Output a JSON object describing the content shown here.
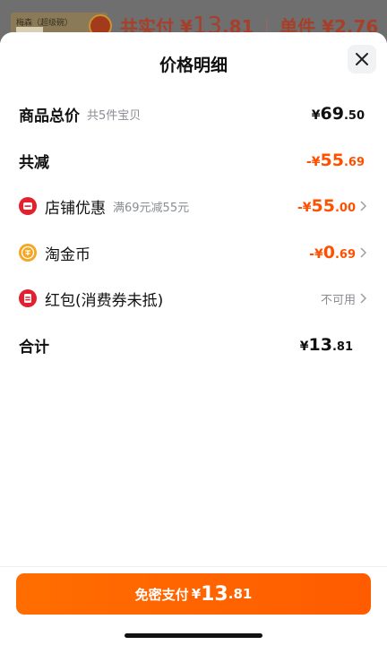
{
  "background": {
    "thumb_label": "梅森（超级碗）",
    "paid_prefix": "共实付",
    "paid_currency": "¥",
    "paid_int": "13",
    "paid_dec": ".81",
    "separator": "|",
    "unit_prefix": "单件",
    "unit_price": "¥2.76"
  },
  "sheet": {
    "title": "价格明细",
    "close_icon": "close-icon"
  },
  "rows": {
    "total_goods": {
      "label": "商品总价",
      "sub": "共5件宝贝",
      "currency": "¥",
      "int": "69",
      "dec": ".50"
    },
    "total_discount": {
      "label": "共减",
      "sign_currency": "-¥",
      "int": "55",
      "dec": ".69"
    },
    "store_discount": {
      "icon": "store-icon",
      "label": "店铺优惠",
      "sub": "满69元减55元",
      "sign_currency": "-¥",
      "int": "55",
      "dec": ".00"
    },
    "taojinbi": {
      "icon": "coin-icon",
      "label": "淘金币",
      "sign_currency": "-¥",
      "int": "0",
      "dec": ".69"
    },
    "red_packet": {
      "icon": "red-packet-icon",
      "label": "红包(消费券未抵)",
      "status": "不可用"
    },
    "grand_total": {
      "label": "合计",
      "currency": "¥",
      "int": "13",
      "dec": ".81"
    }
  },
  "pay_button": {
    "label": "免密支付",
    "currency": "¥",
    "int": "13",
    "dec": ".81"
  },
  "colors": {
    "accent": "#ff5000",
    "button": "#ff6a00",
    "muted": "#8a8d93"
  }
}
